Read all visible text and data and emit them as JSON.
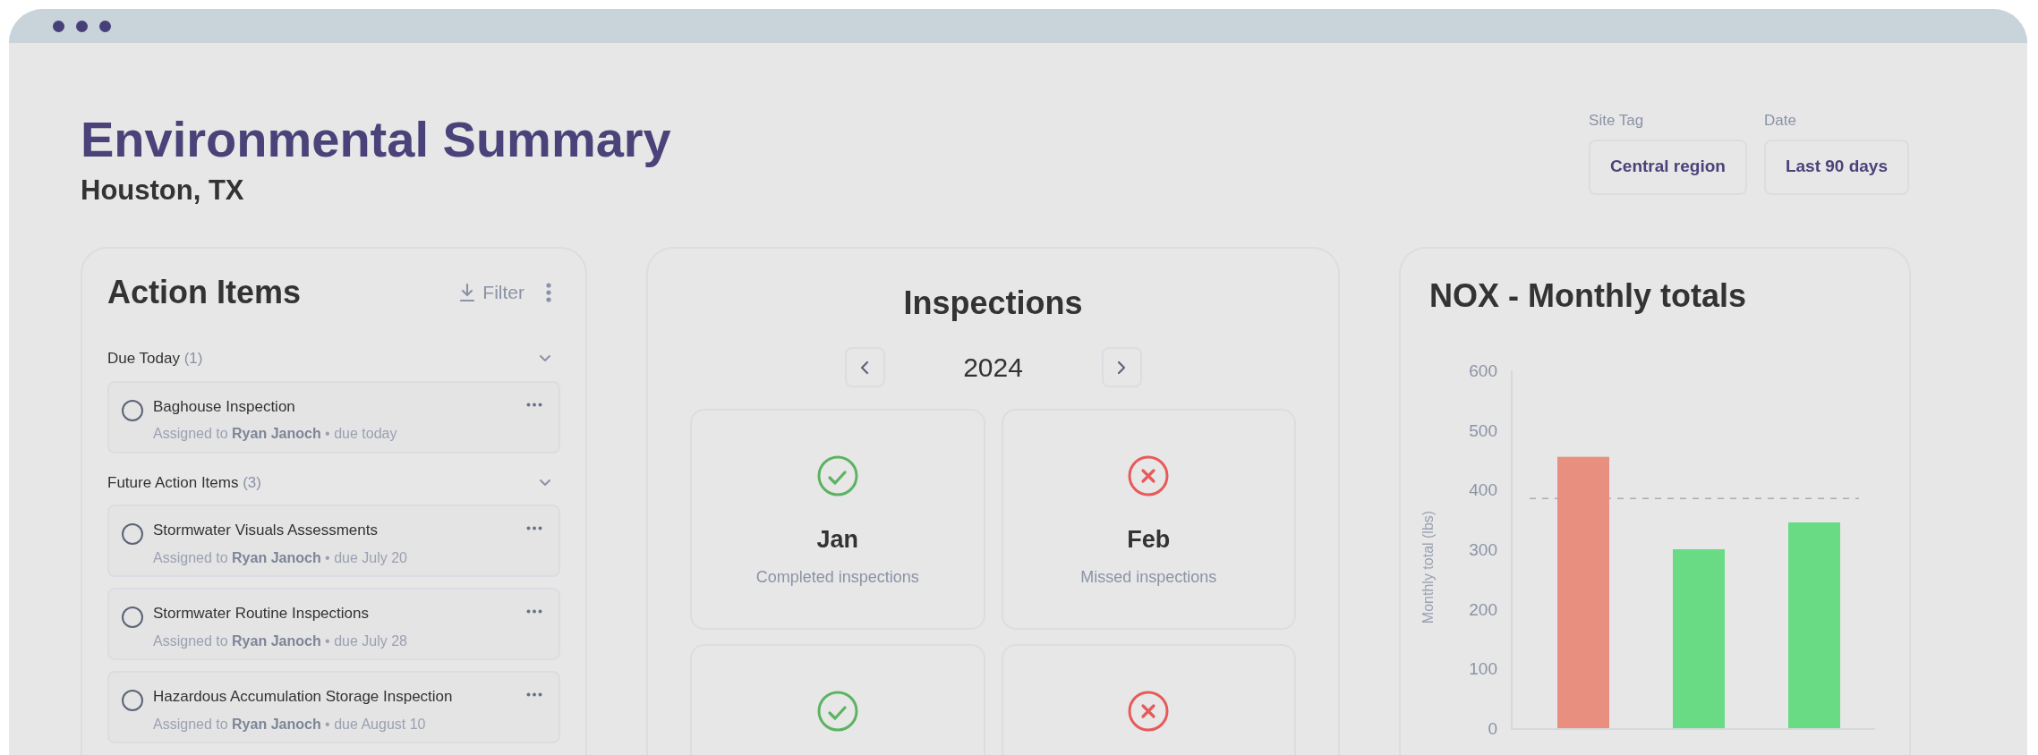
{
  "header": {
    "title": "Environmental Summary",
    "subtitle": "Houston, TX"
  },
  "filters": [
    {
      "label": "Site Tag",
      "value": "Central region"
    },
    {
      "label": "Date",
      "value": "Last 90 days"
    }
  ],
  "action_items": {
    "title": "Action Items",
    "filter_label": "Filter",
    "groups": [
      {
        "title": "Due Today",
        "count": "(1)",
        "expanded": true,
        "items": [
          {
            "title": "Baghouse Inspection",
            "subtitle": "Assigned to **Ryan Janoch** • due today",
            "checked": false
          }
        ]
      },
      {
        "title": "Future Action Items",
        "count": "(3)",
        "expanded": true,
        "items": [
          {
            "title": "Stormwater Visuals Assessments",
            "subtitle": "Assigned to **Ryan Janoch** • due July 20",
            "checked": false
          },
          {
            "title": "Stormwater Routine Inspections",
            "subtitle": "Assigned to **Ryan Janoch** • due July 28",
            "checked": false
          },
          {
            "title": "Hazardous Accumulation Storage Inspection",
            "subtitle": "Assigned to **Ryan Janoch** • due August 10",
            "checked": false
          }
        ]
      }
    ]
  },
  "inspections": {
    "title": "Inspections",
    "year": "2024",
    "months": [
      {
        "month": "Jan",
        "caption": "Completed inspections",
        "kind": "completed"
      },
      {
        "month": "Feb",
        "caption": "Missed inspections",
        "kind": "missed"
      },
      {
        "kind": "completed"
      },
      {
        "kind": "missed"
      }
    ]
  },
  "nox": {
    "title": "NOX - Monthly totals",
    "chart_data": {
      "type": "bar",
      "ylabel": "Monthly total (lbs)",
      "values": [
        455,
        300,
        345
      ],
      "ylim": [
        0,
        600
      ],
      "yticks": [
        0,
        100,
        200,
        300,
        400,
        500,
        600
      ],
      "ref_lines": [
        {
          "axis": "y",
          "value": 385
        }
      ]
    }
  }
}
